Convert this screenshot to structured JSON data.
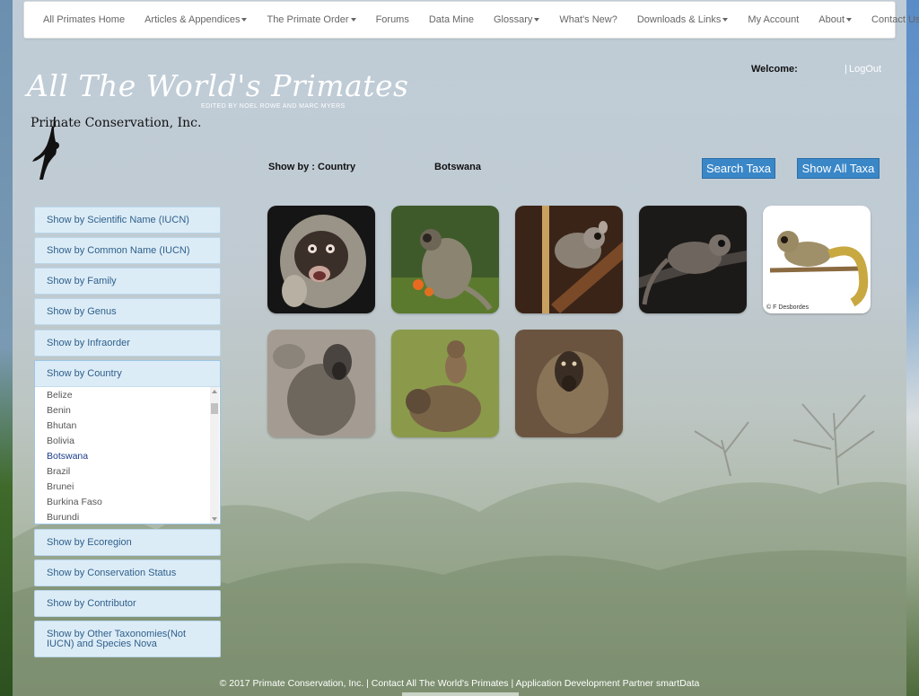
{
  "nav": {
    "items": [
      {
        "label": "All Primates Home",
        "dropdown": false
      },
      {
        "label": "Articles & Appendices",
        "dropdown": true
      },
      {
        "label": "The Primate Order",
        "dropdown": true
      },
      {
        "label": "Forums",
        "dropdown": false
      },
      {
        "label": "Data Mine",
        "dropdown": false
      },
      {
        "label": "Glossary",
        "dropdown": true
      },
      {
        "label": "What's New?",
        "dropdown": false
      },
      {
        "label": "Downloads & Links",
        "dropdown": true
      },
      {
        "label": "My Account",
        "dropdown": false
      },
      {
        "label": "About",
        "dropdown": true
      },
      {
        "label": "Contact Us",
        "dropdown": false
      }
    ]
  },
  "header": {
    "title": "All The World's Primates",
    "subtitle": "EDITED BY NOEL ROWE AND MARC MYERS",
    "logo_text": "Primate Conservation, Inc.",
    "welcome_label": "Welcome:",
    "separator": "|",
    "logout_label": "LogOut"
  },
  "filter": {
    "label": "Show by : Country",
    "value": "Botswana",
    "search_button": "Search Taxa",
    "show_all_button": "Show All Taxa"
  },
  "sidebar": {
    "before": [
      "Show by Scientific Name (IUCN)",
      "Show by Common Name (IUCN)",
      "Show by Family",
      "Show by Genus",
      "Show by Infraorder"
    ],
    "country_heading": "Show by Country",
    "countries": [
      "Belize",
      "Benin",
      "Bhutan",
      "Bolivia",
      "Botswana",
      "Brazil",
      "Brunei",
      "Burkina Faso",
      "Burundi"
    ],
    "selected_country": "Botswana",
    "after": [
      "Show by Ecoregion",
      "Show by Conservation Status",
      "Show by Contributor",
      "Show by Other Taxonomies(Not IUCN) and Species Nova"
    ]
  },
  "thumbnails": [
    {
      "name": "vervet-monkey-face",
      "credit": ""
    },
    {
      "name": "vervet-monkey-sitting",
      "credit": ""
    },
    {
      "name": "bushbaby-on-branch",
      "credit": ""
    },
    {
      "name": "galago-night",
      "credit": ""
    },
    {
      "name": "galago-illustration",
      "credit": "© F Desbordes"
    },
    {
      "name": "baboon-sitting",
      "credit": ""
    },
    {
      "name": "baboon-with-infant",
      "credit": ""
    },
    {
      "name": "chacma-baboon",
      "credit": ""
    }
  ],
  "footer": {
    "text": "© 2017 Primate Conservation, Inc. | Contact All The World's Primates | Application Development Partner smartData"
  },
  "colors": {
    "accent_button": "#3a87c8",
    "sidebar_button": "#dcecf7",
    "sidebar_text": "#2f5f8a",
    "selected_country": "#1a3a8a"
  }
}
